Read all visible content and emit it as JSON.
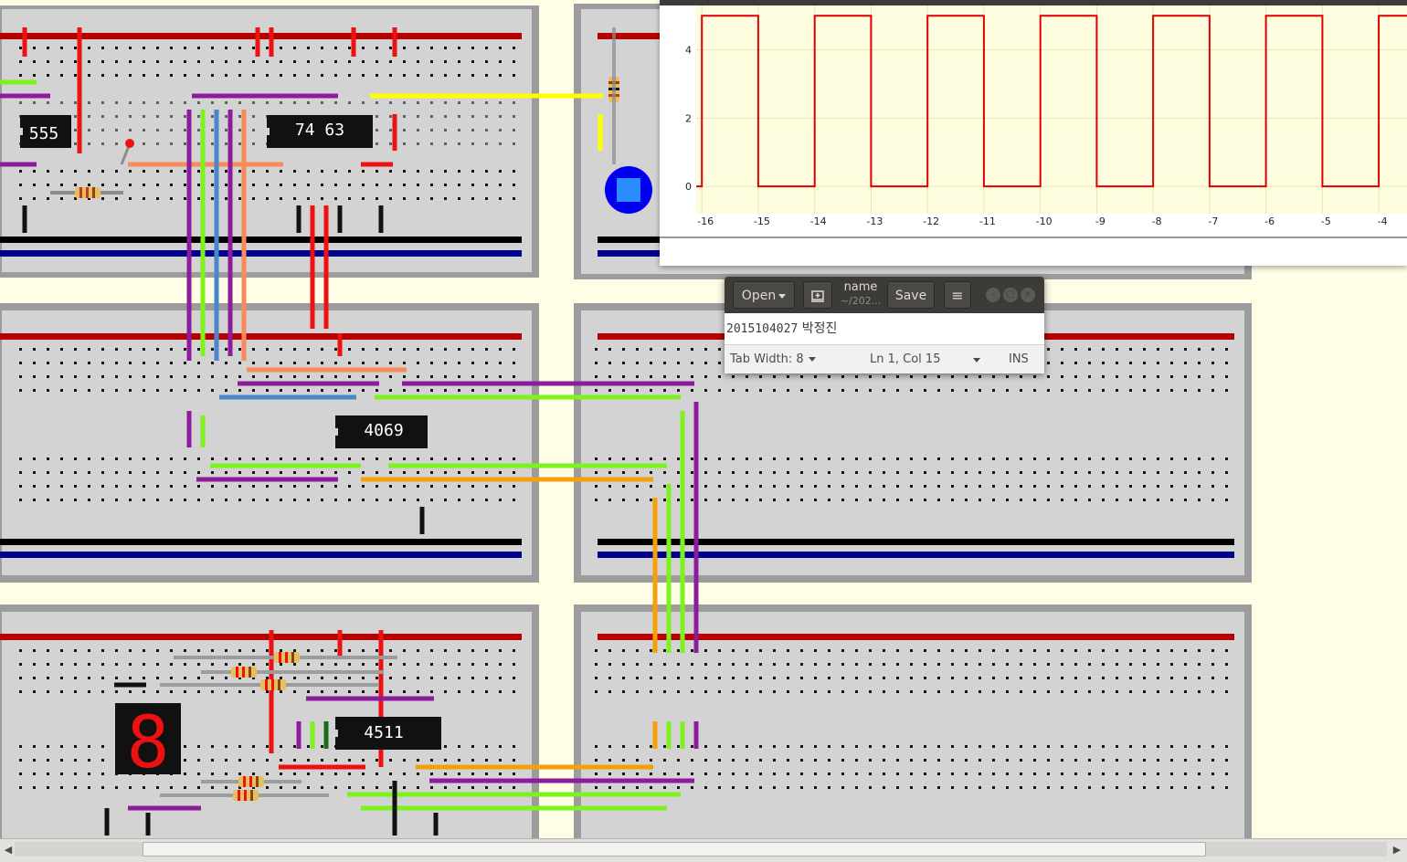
{
  "circuit": {
    "chips": [
      "555",
      "74 63",
      "4069",
      "4511"
    ],
    "display_digit": "8"
  },
  "oscilloscope": {
    "y_ticks": [
      "4",
      "2",
      "0"
    ],
    "x_ticks": [
      "-16",
      "-15",
      "-14",
      "-13",
      "-12",
      "-11",
      "-10",
      "-9",
      "-8",
      "-7",
      "-6",
      "-5",
      "-4"
    ],
    "trace_color": "#e00000",
    "grid_color": "#e6e6b4",
    "background": "#fffde0"
  },
  "chart_data": {
    "type": "line",
    "title": "",
    "xlabel": "",
    "ylabel": "",
    "xlim": [
      -16.1,
      -3.5
    ],
    "ylim": [
      -0.8,
      5.3
    ],
    "series": [
      {
        "x": [
          -16.1,
          -16,
          -16,
          -15,
          -15,
          -14,
          -14,
          -13,
          -13,
          -12,
          -12,
          -11,
          -11,
          -10,
          -10,
          -9,
          -9,
          -8,
          -8,
          -7,
          -7,
          -6,
          -6,
          -5,
          -5,
          -4,
          -4,
          -3.5
        ],
        "y": [
          0,
          0,
          5,
          5,
          0,
          0,
          5,
          5,
          0,
          0,
          5,
          5,
          0,
          0,
          5,
          5,
          0,
          0,
          5,
          5,
          0,
          0,
          5,
          5,
          0,
          0,
          5,
          5
        ]
      }
    ]
  },
  "editor": {
    "open_label": "Open",
    "doc_name": "name",
    "doc_path": "~/202...",
    "save_label": "Save",
    "menu_glyph": "≡",
    "content": "2015104027",
    "content_name": "박정진",
    "tab_width": "Tab Width: 8",
    "cursor_pos": "Ln 1, Col 15",
    "mode": "INS",
    "btn_min": "–",
    "btn_max": "□",
    "btn_close": "×"
  },
  "scrollbar": {
    "left_arrow": "◀",
    "right_arrow": "▶"
  }
}
